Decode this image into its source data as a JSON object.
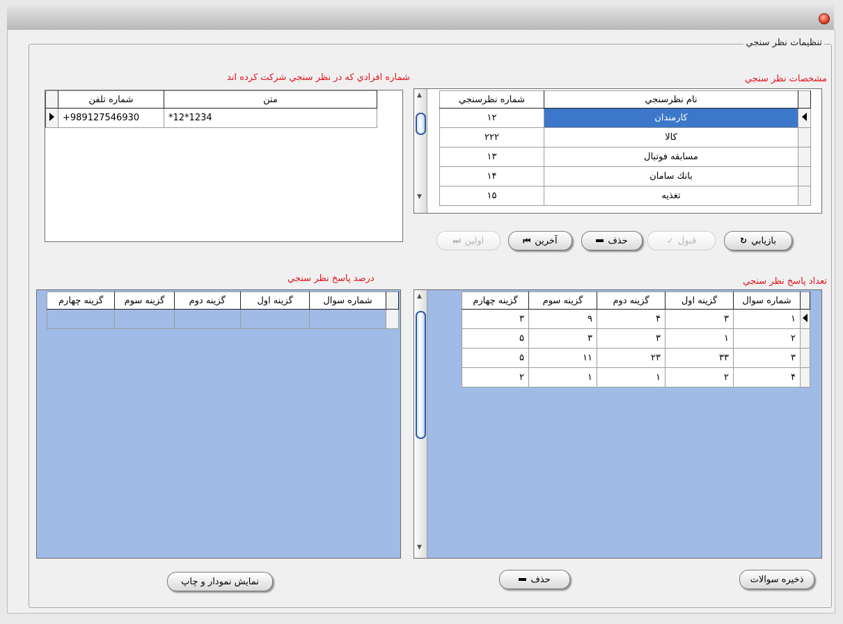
{
  "window": {
    "close_icon": "close-icon"
  },
  "group": {
    "title": "تنظیمات نظر سنجي"
  },
  "surveys": {
    "section_title": "مشخصات نظر سنجي",
    "columns": [
      "نام نظرسنجي",
      "شماره نظرسنجي"
    ],
    "rows": [
      {
        "name": "کارمندان",
        "number": "۱۲",
        "selected": true
      },
      {
        "name": "کالا",
        "number": "۲۲۲"
      },
      {
        "name": "مسابقه فوتبال",
        "number": "۱۳"
      },
      {
        "name": "بانك سامان",
        "number": "۱۴"
      },
      {
        "name": "تغذيه",
        "number": "۱۵"
      }
    ]
  },
  "participants": {
    "section_title": "شماره افرادي كه در نظر سنجي شركت كرده اند",
    "columns": [
      "شماره تلفن",
      "متن"
    ],
    "rows": [
      {
        "phone": "+989127546930",
        "text": "*12*1234"
      }
    ]
  },
  "nav_buttons": {
    "refresh": "بازيابي",
    "accept": "قبول",
    "delete": "حذف",
    "last": "آخرين",
    "first": "اولين"
  },
  "answer_counts": {
    "section_title": "تعداد پاسخ نظر سنجي",
    "columns": [
      "شماره سوال",
      "گزينه اول",
      "گزينه دوم",
      "گزينه سوم",
      "گزينه چهارم"
    ],
    "rows": [
      [
        "۱",
        "۳",
        "۴",
        "۹",
        "۳"
      ],
      [
        "۲",
        "۱",
        "۳",
        "۳",
        "۵"
      ],
      [
        "۳",
        "۳۳",
        "۲۳",
        "۱۱",
        "۵"
      ],
      [
        "۴",
        "۲",
        "۱",
        "۱",
        "۲"
      ]
    ]
  },
  "answer_percent": {
    "section_title": "درصد پاسخ نظر سنجي",
    "columns": [
      "شماره سوال",
      "گزينه اول",
      "گزينه دوم",
      "گزينه سوم",
      "گزينه چهارم"
    ]
  },
  "bottom_buttons": {
    "save_questions": "ذخيره سوالات",
    "delete": "حذف",
    "show_chart_print": "نمايش نمودار و چاپ"
  }
}
